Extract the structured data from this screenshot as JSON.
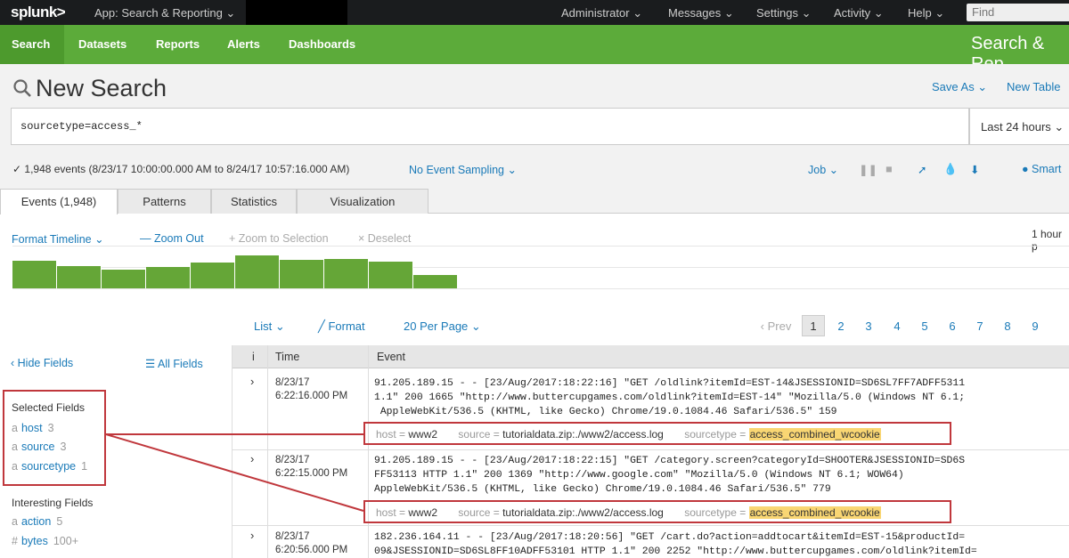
{
  "topbar": {
    "logo": "splunk",
    "logo_suffix": ">",
    "app": "App: Search & Reporting ⌄",
    "menu": [
      "Administrator ⌄",
      "Messages ⌄",
      "Settings ⌄",
      "Activity ⌄",
      "Help ⌄"
    ],
    "find_placeholder": "Find"
  },
  "nav": {
    "items": [
      "Search",
      "Datasets",
      "Reports",
      "Alerts",
      "Dashboards"
    ],
    "app_title": "Search & Rep"
  },
  "search": {
    "title": "New Search",
    "save_as": "Save As ⌄",
    "new_table": "New Table",
    "query": "sourcetype=access_*",
    "time_range": "Last 24 hours ⌄",
    "summary": "✓ 1,948 events (8/23/17 10:00:00.000 AM to 8/24/17 10:57:16.000 AM)",
    "sampling": "No Event Sampling ⌄",
    "job": "Job ⌄",
    "smart": "● Smart"
  },
  "tabs": [
    "Events (1,948)",
    "Patterns",
    "Statistics",
    "Visualization"
  ],
  "timeline": {
    "format": "Format Timeline ⌄",
    "zoom_out": "— Zoom Out",
    "zoom_selection": "+ Zoom to Selection",
    "deselect": "× Deselect",
    "scale": "1 hour p",
    "bar_levels": [
      0.82,
      0.67,
      0.56,
      0.62,
      0.77,
      0.97,
      0.85,
      0.87,
      0.78,
      0.4
    ]
  },
  "results": {
    "list": "List ⌄",
    "format": "╱ Format",
    "per_page": "20 Per Page ⌄",
    "prev": "‹ Prev",
    "pages": [
      "1",
      "2",
      "3",
      "4",
      "5",
      "6",
      "7",
      "8",
      "9"
    ],
    "current_page": "1"
  },
  "sidebar": {
    "hide_fields": "‹ Hide Fields",
    "all_fields": "☰ All Fields",
    "selected_heading": "Selected Fields",
    "selected": [
      {
        "prefix": "a",
        "name": "host",
        "count": "3"
      },
      {
        "prefix": "a",
        "name": "source",
        "count": "3"
      },
      {
        "prefix": "a",
        "name": "sourcetype",
        "count": "1"
      }
    ],
    "interesting_heading": "Interesting Fields",
    "interesting": [
      {
        "prefix": "a",
        "name": "action",
        "count": "5"
      },
      {
        "prefix": "#",
        "name": "bytes",
        "count": "100+"
      }
    ]
  },
  "table": {
    "col_info": "i",
    "col_time": "Time",
    "col_event": "Event",
    "rows": [
      {
        "date": "8/23/17",
        "time": "6:22:16.000 PM",
        "event": "91.205.189.15 - - [23/Aug/2017:18:22:16] \"GET /oldlink?itemId=EST-14&JSESSIONID=SD6SL7FF7ADFF5311\n1.1\" 200 1665 \"http://www.buttercupgames.com/oldlink?itemId=EST-14\" \"Mozilla/5.0 (Windows NT 6.1;\n AppleWebKit/536.5 (KHTML, like Gecko) Chrome/19.0.1084.46 Safari/536.5\" 159",
        "host_key": "host =",
        "host": "www2",
        "source_key": "source =",
        "source": "tutorialdata.zip:./www2/access.log",
        "sourcetype_key": "sourcetype =",
        "sourcetype": "access_combined_wcookie"
      },
      {
        "date": "8/23/17",
        "time": "6:22:15.000 PM",
        "event": "91.205.189.15 - - [23/Aug/2017:18:22:15] \"GET /category.screen?categoryId=SHOOTER&JSESSIONID=SD6S\nFF53113 HTTP 1.1\" 200 1369 \"http://www.google.com\" \"Mozilla/5.0 (Windows NT 6.1; WOW64)\nAppleWebKit/536.5 (KHTML, like Gecko) Chrome/19.0.1084.46 Safari/536.5\" 779",
        "host_key": "host =",
        "host": "www2",
        "source_key": "source =",
        "source": "tutorialdata.zip:./www2/access.log",
        "sourcetype_key": "sourcetype =",
        "sourcetype": "access_combined_wcookie"
      },
      {
        "date": "8/23/17",
        "time": "6:20:56.000 PM",
        "event": "182.236.164.11 - - [23/Aug/2017:18:20:56] \"GET /cart.do?action=addtocart&itemId=EST-15&productId=\n09&JSESSIONID=SD6SL8FF10ADFF53101 HTTP 1.1\" 200 2252 \"http://www.buttercupgames.com/oldlink?itemId="
      }
    ]
  },
  "colors": {
    "green": "#5cab3a",
    "bar": "#65a637",
    "link": "#1a7ab8",
    "highlight_box": "#c0373c",
    "term_highlight": "#f9d673"
  }
}
